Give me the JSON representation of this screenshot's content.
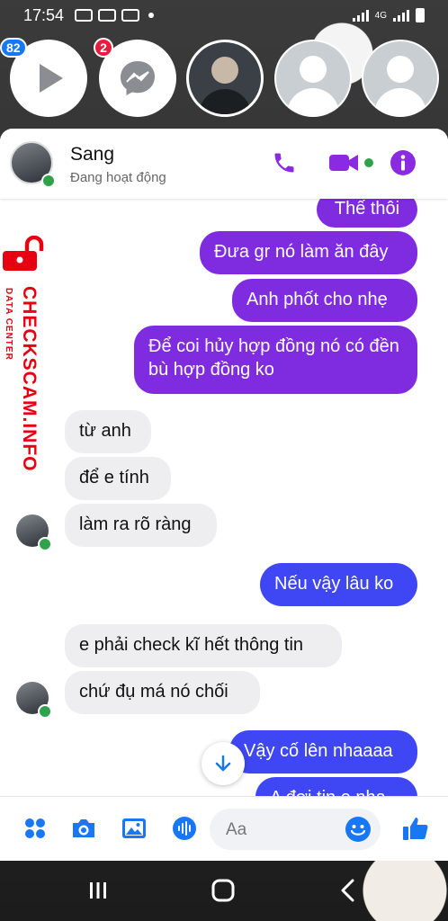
{
  "status_bar": {
    "time": "17:54",
    "network": "4G"
  },
  "chat_heads": {
    "video_badge": "82",
    "messenger_badge": "2"
  },
  "conversation": {
    "name": "Sang",
    "status": "Đang hoạt động"
  },
  "messages": [
    {
      "side": "out",
      "text": "Thế thôi"
    },
    {
      "side": "out",
      "text": "Đưa gr nó làm ăn đây"
    },
    {
      "side": "out",
      "text": "Anh phốt cho nhẹ"
    },
    {
      "side": "out",
      "text": "Để coi hủy hợp đồng nó có đền bù hợp đồng ko"
    },
    {
      "side": "in",
      "text": "từ anh"
    },
    {
      "side": "in",
      "text": "để e tính"
    },
    {
      "side": "in",
      "text": "làm ra rõ ràng"
    },
    {
      "side": "out",
      "text": "Nếu vậy lâu ko"
    },
    {
      "side": "in",
      "text": "e phải check kĩ hết thông tin"
    },
    {
      "side": "in",
      "text": "chứ đụ má nó chối"
    },
    {
      "side": "out",
      "text": "Vậy cố lên nhaaaa"
    },
    {
      "side": "out",
      "text": "A đợi tin e nha"
    }
  ],
  "watermark": {
    "main": "CHECKSCAM.INFO",
    "sub": "DATA CENTER"
  },
  "composer": {
    "placeholder": "Aa"
  },
  "colors": {
    "messenger_purple": "#7f2ce0",
    "messenger_blue": "#3f47f5",
    "incoming_bubble": "#eeeef0",
    "online_green": "#31a24c",
    "watermark_red": "#e60012"
  },
  "icons": [
    "video-play-icon",
    "messenger-icon",
    "phone-icon",
    "video-camera-icon",
    "info-icon",
    "arrow-down-icon",
    "apps-icon",
    "camera-icon",
    "image-icon",
    "microphone-icon",
    "emoji-icon",
    "thumbs-up-icon",
    "recents-icon",
    "home-icon",
    "back-icon",
    "lock-icon"
  ]
}
